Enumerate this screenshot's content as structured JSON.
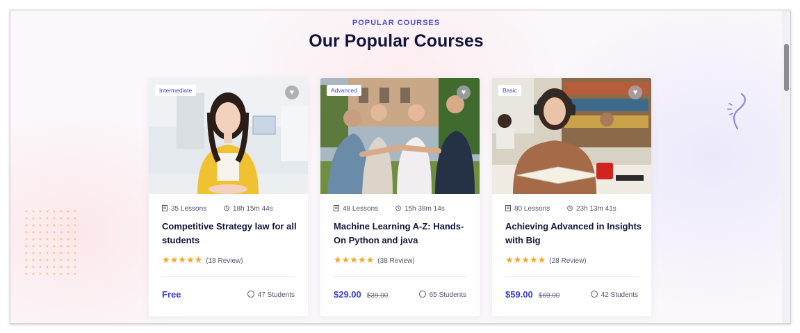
{
  "section": {
    "tag": "POPULAR COURSES",
    "title": "Our Popular Courses"
  },
  "icons": {
    "lessons": "book-icon",
    "duration": "clock-icon",
    "students": "user-icon",
    "wishlist": "heart-icon",
    "rating": "star-icon"
  },
  "colors": {
    "accent": "#3d43c8",
    "title": "#13163a",
    "star": "#f5a623"
  },
  "courses": [
    {
      "level": "Intermediate",
      "lessons": "35 Lessons",
      "duration": "18h 15m 44s",
      "title": "Competitive Strategy law for all students",
      "stars": "★★★★★",
      "rating_value": 5,
      "reviews": "(18 Review)",
      "price": "Free",
      "old_price": "",
      "students": "47 Students"
    },
    {
      "level": "Advanced",
      "lessons": "48 Lessons",
      "duration": "15h 38m 14s",
      "title": "Machine Learning A-Z: Hands-On Python and java",
      "stars": "★★★★★",
      "rating_value": 5,
      "reviews": "(38 Review)",
      "price": "$29.00",
      "old_price": "$39.00",
      "students": "65 Students"
    },
    {
      "level": "Basic",
      "lessons": "80 Lessons",
      "duration": "23h 13m 41s",
      "title": "Achieving Advanced in Insights with Big",
      "stars": "★★★★★",
      "rating_value": 5,
      "reviews": "(28 Review)",
      "price": "$59.00",
      "old_price": "$69.00",
      "students": "42 Students"
    }
  ]
}
